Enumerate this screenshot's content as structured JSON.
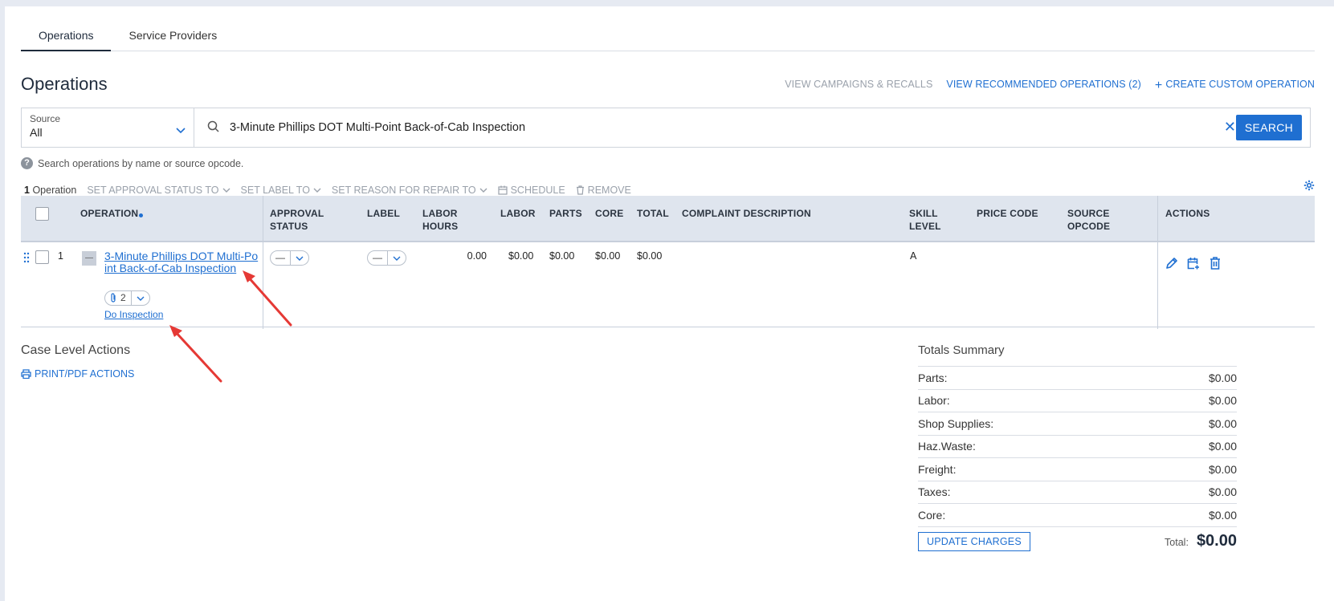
{
  "tabs": [
    {
      "label": "Operations",
      "active": true
    },
    {
      "label": "Service Providers",
      "active": false
    }
  ],
  "header": {
    "title": "Operations",
    "links": {
      "campaigns": "VIEW CAMPAIGNS & RECALLS",
      "recommended": "VIEW RECOMMENDED OPERATIONS (2)",
      "create": "CREATE CUSTOM OPERATION"
    }
  },
  "search": {
    "source_label": "Source",
    "source_value": "All",
    "query": "3-Minute Phillips DOT Multi-Point Back-of-Cab Inspection",
    "button_label": "SEARCH",
    "hint": "Search operations by name or source opcode."
  },
  "bulk": {
    "count_num": "1",
    "count_label": "Operation",
    "set_approval": "SET APPROVAL STATUS TO",
    "set_label": "SET LABEL TO",
    "set_reason": "SET REASON FOR REPAIR TO",
    "schedule": "SCHEDULE",
    "remove": "REMOVE"
  },
  "table": {
    "headers": {
      "operation": "OPERATION",
      "approval_1": "APPROVAL",
      "approval_2": "STATUS",
      "label": "LABEL",
      "labor_hours_1": "LABOR",
      "labor_hours_2": "HOURS",
      "labor": "LABOR",
      "parts": "PARTS",
      "core": "CORE",
      "total": "TOTAL",
      "complaint": "COMPLAINT DESCRIPTION",
      "skill_1": "SKILL",
      "skill_2": "LEVEL",
      "price_code": "PRICE CODE",
      "source_1": "SOURCE",
      "source_2": "OPCODE",
      "actions": "ACTIONS"
    },
    "rows": [
      {
        "index": "1",
        "name": "3-Minute Phillips DOT Multi-Point Back-of-Cab Inspection",
        "collapse": "—",
        "attachments": "2",
        "inspection_link": "Do Inspection",
        "approval": "—",
        "label": "—",
        "labor_hours": "0.00",
        "labor": "$0.00",
        "parts": "$0.00",
        "core": "$0.00",
        "total": "$0.00",
        "skill": "A"
      }
    ]
  },
  "case_level": {
    "title": "Case Level Actions",
    "print": "PRINT/PDF ACTIONS"
  },
  "totals": {
    "title": "Totals Summary",
    "rows": [
      {
        "label": "Parts:",
        "value": "$0.00"
      },
      {
        "label": "Labor:",
        "value": "$0.00"
      },
      {
        "label": "Shop Supplies:",
        "value": "$0.00"
      },
      {
        "label": "Haz.Waste:",
        "value": "$0.00"
      },
      {
        "label": "Freight:",
        "value": "$0.00"
      },
      {
        "label": "Taxes:",
        "value": "$0.00"
      },
      {
        "label": "Core:",
        "value": "$0.00"
      }
    ],
    "update_button": "UPDATE CHARGES",
    "total_label": "Total:",
    "total_value": "$0.00"
  },
  "colors": {
    "accent": "#1f6fd1",
    "header_bg": "#dfe5ee",
    "arrow": "#e53935"
  }
}
